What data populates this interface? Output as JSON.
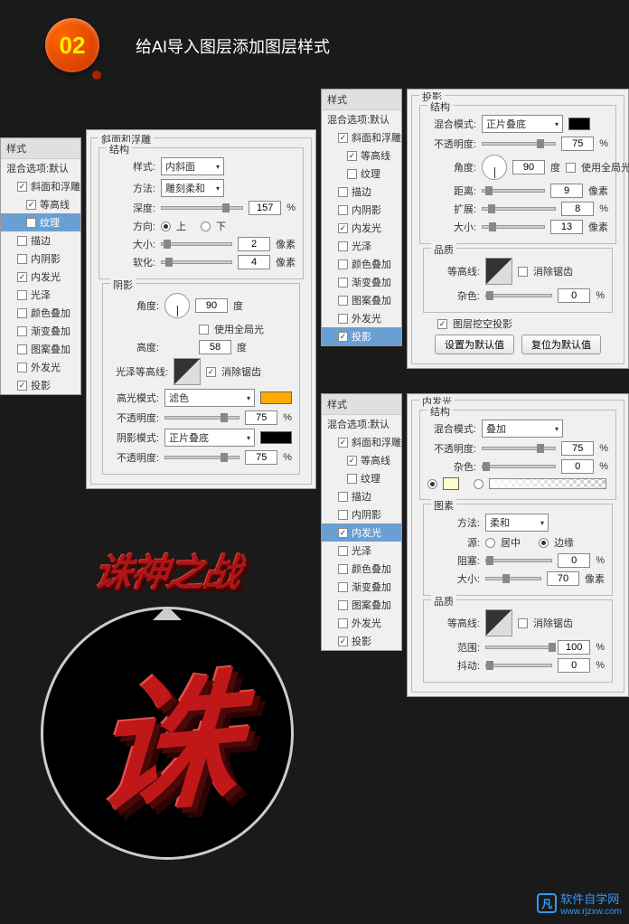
{
  "step": {
    "number": "02",
    "title": "给AI导入图层添加图层样式"
  },
  "panel1": {
    "title": "样式",
    "blendDefault": "混合选项:默认",
    "effects": [
      {
        "label": "斜面和浮雕",
        "checked": true,
        "active": false
      },
      {
        "label": "等高线",
        "checked": true,
        "indent": true
      },
      {
        "label": "纹理",
        "checked": false,
        "indent": true,
        "active": true
      },
      {
        "label": "描边",
        "checked": false
      },
      {
        "label": "内阴影",
        "checked": false
      },
      {
        "label": "内发光",
        "checked": true
      },
      {
        "label": "光泽",
        "checked": false
      },
      {
        "label": "颜色叠加",
        "checked": false
      },
      {
        "label": "渐变叠加",
        "checked": false
      },
      {
        "label": "图案叠加",
        "checked": false
      },
      {
        "label": "外发光",
        "checked": false
      },
      {
        "label": "投影",
        "checked": true
      }
    ],
    "bevel": {
      "title": "斜面和浮雕",
      "structure": "结构",
      "styleLabel": "样式:",
      "styleValue": "内斜面",
      "techLabel": "方法:",
      "techValue": "雕刻柔和",
      "depthLabel": "深度:",
      "depthValue": "157",
      "pct": "%",
      "dirLabel": "方向:",
      "up": "上",
      "down": "下",
      "sizeLabel": "大小:",
      "sizeValue": "2",
      "px": "像素",
      "softenLabel": "软化:",
      "softenValue": "4",
      "shading": "阴影",
      "angleLabel": "角度:",
      "angleValue": "90",
      "deg": "度",
      "globalLabel": "使用全局光",
      "altLabel": "高度:",
      "altValue": "58",
      "glossLabel": "光泽等高线:",
      "antiAlias": "消除锯齿",
      "hlModeLabel": "高光模式:",
      "hlValue": "滤色",
      "opacityLabel": "不透明度:",
      "hlOpacity": "75",
      "shModeLabel": "阴影模式:",
      "shValue": "正片叠底",
      "shOpacity": "75"
    }
  },
  "panel2": {
    "title": "样式",
    "blendDefault": "混合选项:默认",
    "effects": [
      {
        "label": "斜面和浮雕",
        "checked": true
      },
      {
        "label": "等高线",
        "checked": true,
        "indent": true
      },
      {
        "label": "纹理",
        "checked": false,
        "indent": true
      },
      {
        "label": "描边",
        "checked": false
      },
      {
        "label": "内阴影",
        "checked": false
      },
      {
        "label": "内发光",
        "checked": true
      },
      {
        "label": "光泽",
        "checked": false
      },
      {
        "label": "颜色叠加",
        "checked": false
      },
      {
        "label": "渐变叠加",
        "checked": false
      },
      {
        "label": "图案叠加",
        "checked": false
      },
      {
        "label": "外发光",
        "checked": false
      },
      {
        "label": "投影",
        "checked": true,
        "active": true
      }
    ],
    "shadow": {
      "title": "投影",
      "structure": "结构",
      "blendLabel": "混合模式:",
      "blendValue": "正片叠底",
      "opacityLabel": "不透明度:",
      "opacityValue": "75",
      "pct": "%",
      "angleLabel": "角度:",
      "angleValue": "90",
      "deg": "度",
      "globalLabel": "使用全局光",
      "distLabel": "距离:",
      "distValue": "9",
      "px": "像素",
      "spreadLabel": "扩展:",
      "spreadValue": "8",
      "sizeLabel": "大小:",
      "sizeValue": "13",
      "quality": "品质",
      "contourLabel": "等高线:",
      "antiAlias": "消除锯齿",
      "noiseLabel": "杂色:",
      "noiseValue": "0",
      "knockoutLabel": "图层挖空投影",
      "btnDefault": "设置为默认值",
      "btnReset": "复位为默认值"
    }
  },
  "panel3": {
    "title": "样式",
    "blendDefault": "混合选项:默认",
    "effects": [
      {
        "label": "斜面和浮雕",
        "checked": true
      },
      {
        "label": "等高线",
        "checked": true,
        "indent": true
      },
      {
        "label": "纹理",
        "checked": false,
        "indent": true
      },
      {
        "label": "描边",
        "checked": false
      },
      {
        "label": "内阴影",
        "checked": false
      },
      {
        "label": "内发光",
        "checked": true,
        "active": true
      },
      {
        "label": "光泽",
        "checked": false
      },
      {
        "label": "颜色叠加",
        "checked": false
      },
      {
        "label": "渐变叠加",
        "checked": false
      },
      {
        "label": "图案叠加",
        "checked": false
      },
      {
        "label": "外发光",
        "checked": false
      },
      {
        "label": "投影",
        "checked": true
      }
    ],
    "glow": {
      "title": "内发光",
      "structure": "结构",
      "blendLabel": "混合模式:",
      "blendValue": "叠加",
      "opacityLabel": "不透明度:",
      "opacityValue": "75",
      "pct": "%",
      "noiseLabel": "杂色:",
      "noiseValue": "0",
      "elements": "图素",
      "techLabel": "方法:",
      "techValue": "柔和",
      "srcLabel": "源:",
      "center": "居中",
      "edge": "边缘",
      "chokeLabel": "阻塞:",
      "chokeValue": "0",
      "sizeLabel": "大小:",
      "sizeValue": "70",
      "px": "像素",
      "quality": "品质",
      "contourLabel": "等高线:",
      "antiAlias": "消除锯齿",
      "rangeLabel": "范围:",
      "rangeValue": "100",
      "jitterLabel": "抖动:",
      "jitterValue": "0"
    }
  },
  "preview": {
    "text": "诛神之战",
    "char": "诛"
  },
  "watermark": {
    "icon": "凡",
    "text": "软件自学网",
    "url": "www.rjzxw.com"
  }
}
